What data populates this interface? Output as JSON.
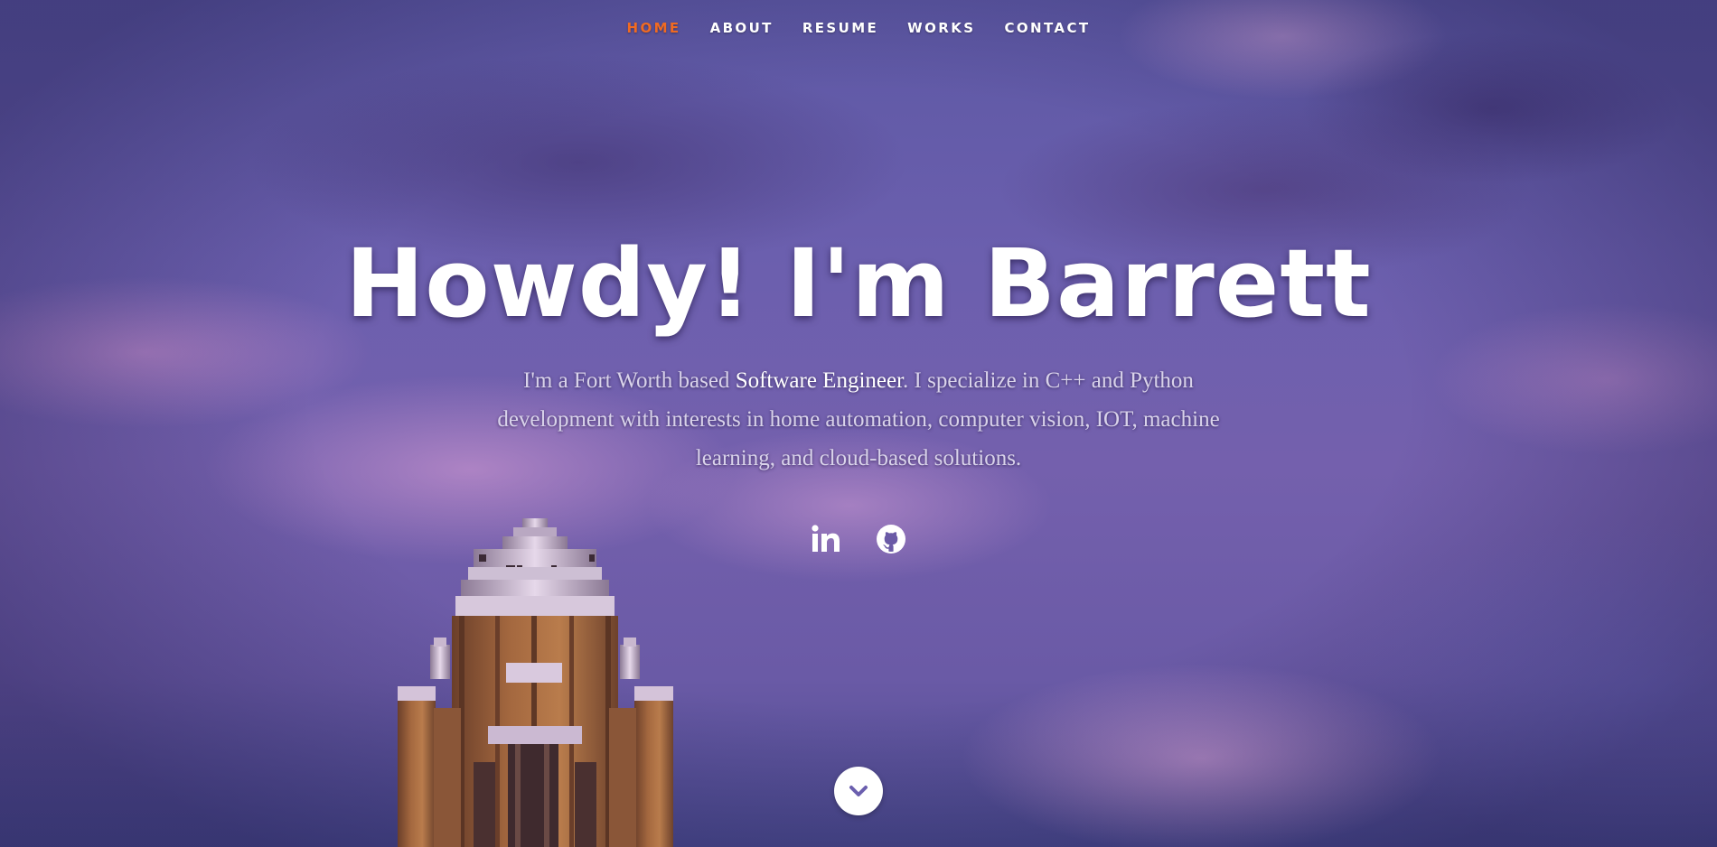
{
  "nav": {
    "items": [
      {
        "label": "HOME",
        "active": true
      },
      {
        "label": "ABOUT",
        "active": false
      },
      {
        "label": "RESUME",
        "active": false
      },
      {
        "label": "WORKS",
        "active": false
      },
      {
        "label": "CONTACT",
        "active": false
      }
    ],
    "active_color": "#f06a22"
  },
  "hero": {
    "headline": "Howdy! I'm Barrett",
    "intro_before": "I'm a Fort Worth based ",
    "intro_highlight": "Software Engineer",
    "intro_after": ". I specialize in C++ and Python development with interests in home automation, computer vision, IOT, machine learning, and cloud-based solutions."
  },
  "social": [
    {
      "icon": "linkedin-icon"
    },
    {
      "icon": "github-icon"
    }
  ],
  "scroll": {
    "icon": "chevron-down-icon"
  }
}
